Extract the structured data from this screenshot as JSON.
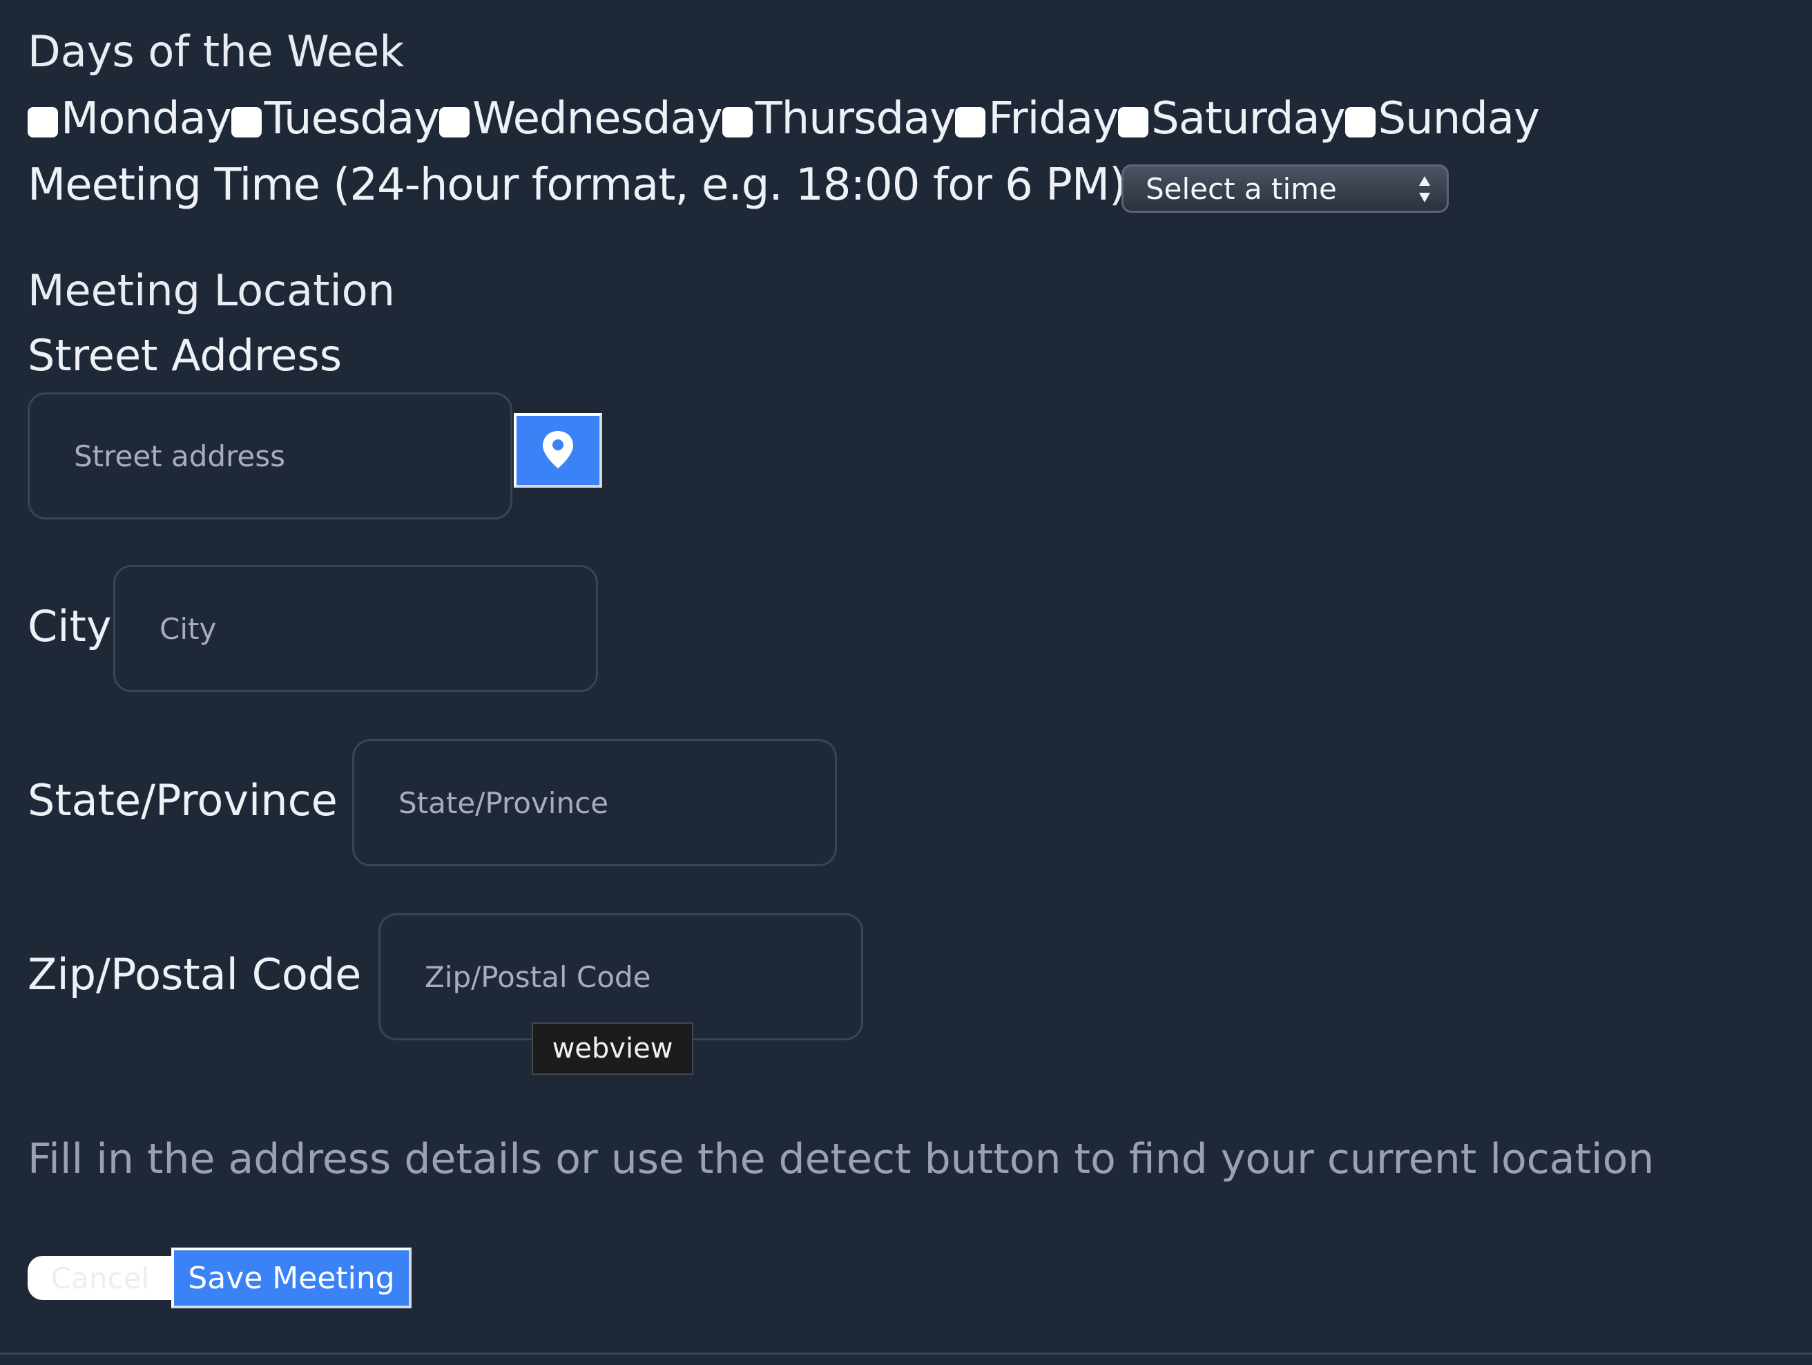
{
  "schedule": {
    "days_heading": "Days of the Week",
    "days": [
      {
        "label": "Monday",
        "checked": false
      },
      {
        "label": "Tuesday",
        "checked": false
      },
      {
        "label": "Wednesday",
        "checked": false
      },
      {
        "label": "Thursday",
        "checked": false
      },
      {
        "label": "Friday",
        "checked": false
      },
      {
        "label": "Saturday",
        "checked": false
      },
      {
        "label": "Sunday",
        "checked": false
      }
    ],
    "time_label": "Meeting Time (24-hour format, e.g. 18:00 for 6 PM)",
    "time_select_value": "Select a time"
  },
  "location": {
    "heading": "Meeting Location",
    "street_label": "Street Address",
    "street_placeholder": "Street address",
    "detect_icon": "map-pin-icon",
    "city_label": "City",
    "city_placeholder": "City",
    "state_label": "State/Province",
    "state_placeholder": "State/Province",
    "zip_label": "Zip/Postal Code",
    "zip_placeholder": "Zip/Postal Code",
    "tooltip": "webview",
    "help_text": "Fill in the address details or use the detect button to find your current location"
  },
  "actions": {
    "cancel_label": "Cancel",
    "save_label": "Save Meeting"
  },
  "colors": {
    "background": "#1f2837",
    "accent": "#3b82f6",
    "muted_text": "#9aa2af"
  }
}
